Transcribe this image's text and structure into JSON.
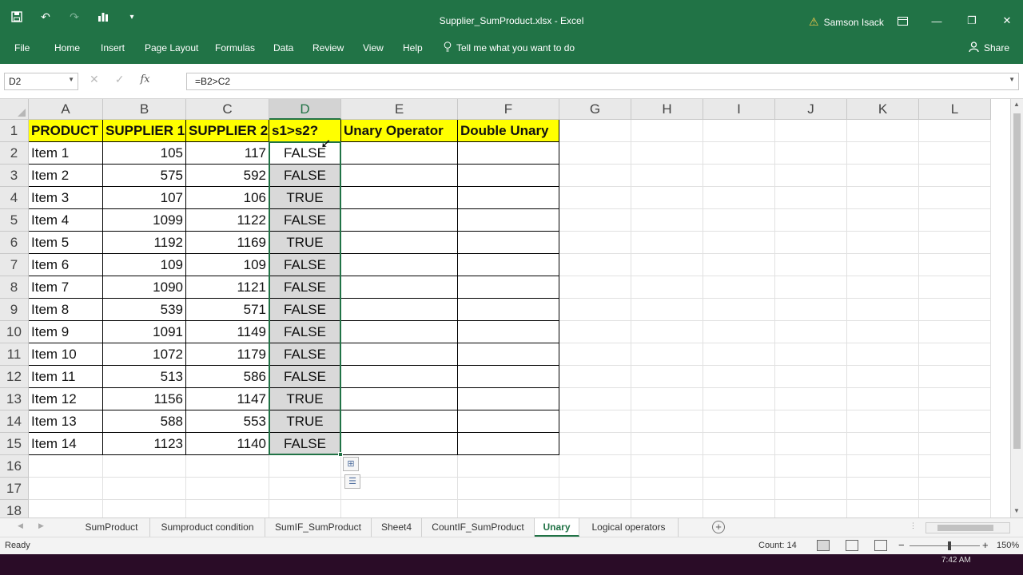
{
  "window": {
    "title": "Supplier_SumProduct.xlsx  -  Excel",
    "user": "Samson Isack"
  },
  "ribbon": {
    "tabs": [
      "File",
      "Home",
      "Insert",
      "Page Layout",
      "Formulas",
      "Data",
      "Review",
      "View",
      "Help"
    ],
    "tell_me": "Tell me what you want to do",
    "share": "Share"
  },
  "formula_bar": {
    "name_box": "D2",
    "formula": "=B2>C2"
  },
  "columns": [
    "A",
    "B",
    "C",
    "D",
    "E",
    "F",
    "G",
    "H",
    "I",
    "J",
    "K",
    "L"
  ],
  "row_numbers": [
    "1",
    "2",
    "3",
    "4",
    "5",
    "6",
    "7",
    "8",
    "9",
    "10",
    "11",
    "12",
    "13",
    "14",
    "15",
    "16",
    "17",
    "18"
  ],
  "table": {
    "headers": [
      "PRODUCT",
      "SUPPLIER 1",
      "SUPPLIER 2",
      "s1>s2?",
      "Unary Operator",
      "Double Unary"
    ],
    "rows": [
      [
        "Item 1",
        "105",
        "117",
        "FALSE"
      ],
      [
        "Item 2",
        "575",
        "592",
        "FALSE"
      ],
      [
        "Item 3",
        "107",
        "106",
        "TRUE"
      ],
      [
        "Item 4",
        "1099",
        "1122",
        "FALSE"
      ],
      [
        "Item 5",
        "1192",
        "1169",
        "TRUE"
      ],
      [
        "Item 6",
        "109",
        "109",
        "FALSE"
      ],
      [
        "Item 7",
        "1090",
        "1121",
        "FALSE"
      ],
      [
        "Item 8",
        "539",
        "571",
        "FALSE"
      ],
      [
        "Item 9",
        "1091",
        "1149",
        "FALSE"
      ],
      [
        "Item 10",
        "1072",
        "1179",
        "FALSE"
      ],
      [
        "Item 11",
        "513",
        "586",
        "FALSE"
      ],
      [
        "Item 12",
        "1156",
        "1147",
        "TRUE"
      ],
      [
        "Item 13",
        "588",
        "553",
        "TRUE"
      ],
      [
        "Item 14",
        "1123",
        "1140",
        "FALSE"
      ]
    ]
  },
  "sheets": {
    "tabs": [
      "SumProduct",
      "Sumproduct condition",
      "SumIF_SumProduct",
      "Sheet4",
      "CountIF_SumProduct",
      "Unary",
      "Logical operators"
    ],
    "active": "Unary"
  },
  "status": {
    "ready": "Ready",
    "count": "Count: 14",
    "zoom": "150%"
  },
  "taskbar": {
    "clock": "7:42 AM"
  },
  "colors": {
    "excel_green": "#217346",
    "header_fill": "#ffff00",
    "selection": "#d9d9d9"
  }
}
